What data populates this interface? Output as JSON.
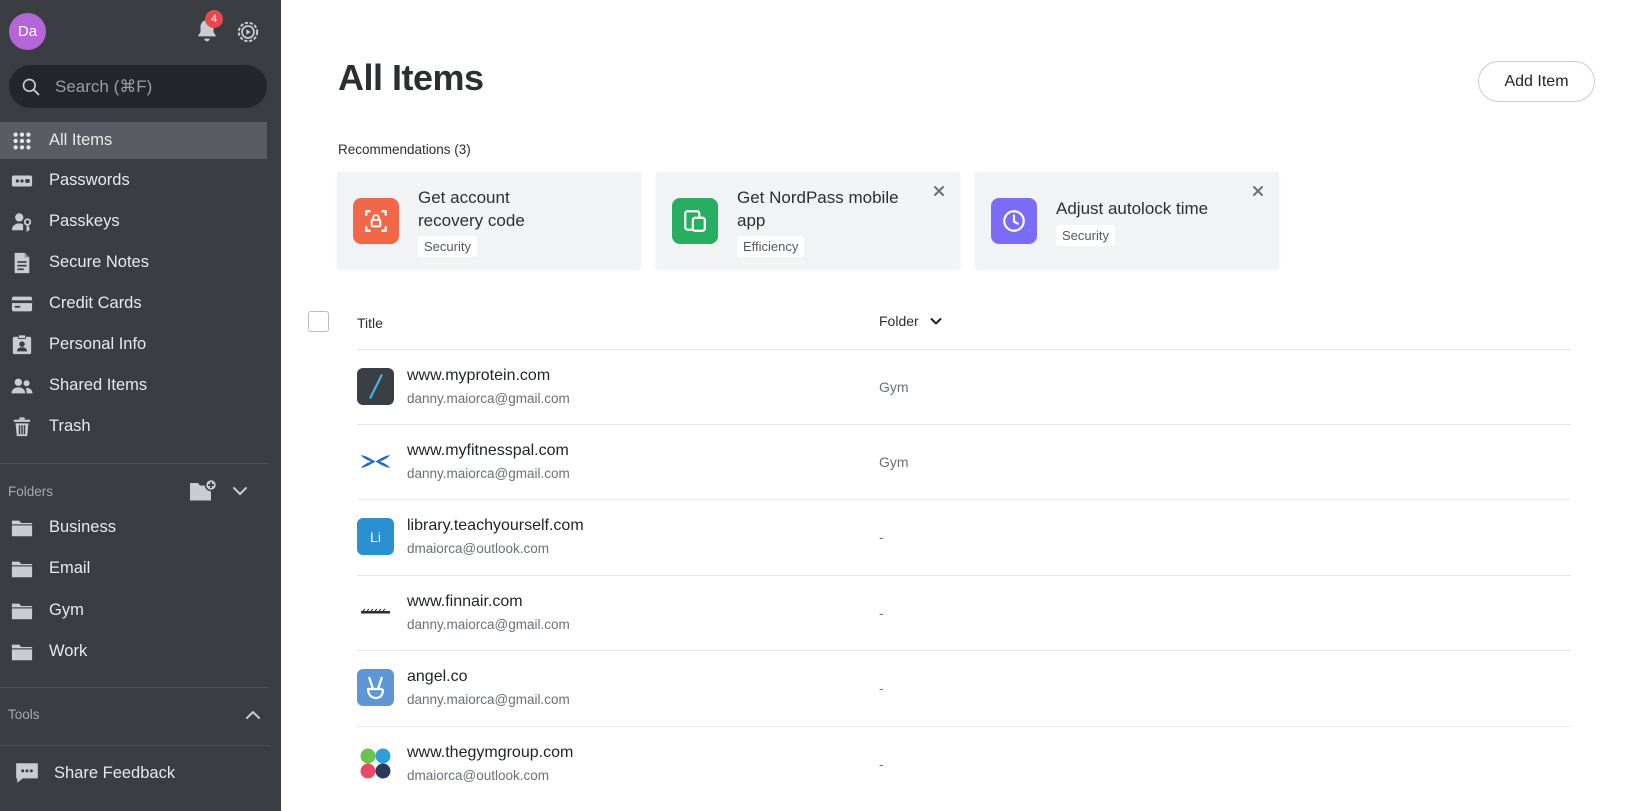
{
  "user": {
    "avatar_initials": "Da",
    "notification_count": "4"
  },
  "search": {
    "placeholder": "Search (⌘F)"
  },
  "nav": {
    "items": [
      {
        "label": "All Items",
        "icon": "grid-icon"
      },
      {
        "label": "Passwords",
        "icon": "password-icon"
      },
      {
        "label": "Passkeys",
        "icon": "passkey-icon"
      },
      {
        "label": "Secure Notes",
        "icon": "note-icon"
      },
      {
        "label": "Credit Cards",
        "icon": "credit-card-icon"
      },
      {
        "label": "Personal Info",
        "icon": "id-card-icon"
      },
      {
        "label": "Shared Items",
        "icon": "users-icon"
      },
      {
        "label": "Trash",
        "icon": "trash-icon"
      }
    ]
  },
  "folders": {
    "label": "Folders",
    "items": [
      {
        "label": "Business"
      },
      {
        "label": "Email"
      },
      {
        "label": "Gym"
      },
      {
        "label": "Work"
      }
    ]
  },
  "tools": {
    "label": "Tools"
  },
  "feedback": {
    "label": "Share Feedback"
  },
  "main": {
    "title": "All Items",
    "add_button": "Add Item",
    "recommendations_label": "Recommendations (3)",
    "recommendations": [
      {
        "title_line1": "Get account",
        "title_line2": "recovery code",
        "tag": "Security",
        "icon_color": "#f0674a",
        "icon": "recovery-code-icon",
        "closable": false
      },
      {
        "title_line1": "Get NordPass mobile",
        "title_line2": "app",
        "tag": "Efficiency",
        "icon_color": "#27ae60",
        "icon": "devices-icon",
        "closable": true
      },
      {
        "title_line1": "Adjust autolock time",
        "title_line2": "",
        "tag": "Security",
        "icon_color": "#7b6cf6",
        "icon": "clock-icon",
        "closable": true
      }
    ],
    "columns": {
      "title": "Title",
      "folder": "Folder"
    },
    "rows": [
      {
        "title": "www.myprotein.com",
        "username": "danny.maiorca@gmail.com",
        "folder": "Gym",
        "icon": "myprotein-logo"
      },
      {
        "title": "www.myfitnesspal.com",
        "username": "danny.maiorca@gmail.com",
        "folder": "Gym",
        "icon": "under-armour-logo"
      },
      {
        "title": "library.teachyourself.com",
        "username": "dmaiorca@outlook.com",
        "folder": "-",
        "icon": "letter-avatar",
        "icon_text": "Li"
      },
      {
        "title": "www.finnair.com",
        "username": "danny.maiorca@gmail.com",
        "folder": "-",
        "icon": "finnair-logo"
      },
      {
        "title": "angel.co",
        "username": "danny.maiorca@gmail.com",
        "folder": "-",
        "icon": "angel-logo"
      },
      {
        "title": "www.thegymgroup.com",
        "username": "dmaiorca@outlook.com",
        "folder": "-",
        "icon": "gymgroup-logo"
      }
    ]
  },
  "colors": {
    "sidebar_bg": "#3a3d42",
    "sidebar_active": "#595c62",
    "badge": "#e5484d",
    "avatar": "#b466d8"
  }
}
